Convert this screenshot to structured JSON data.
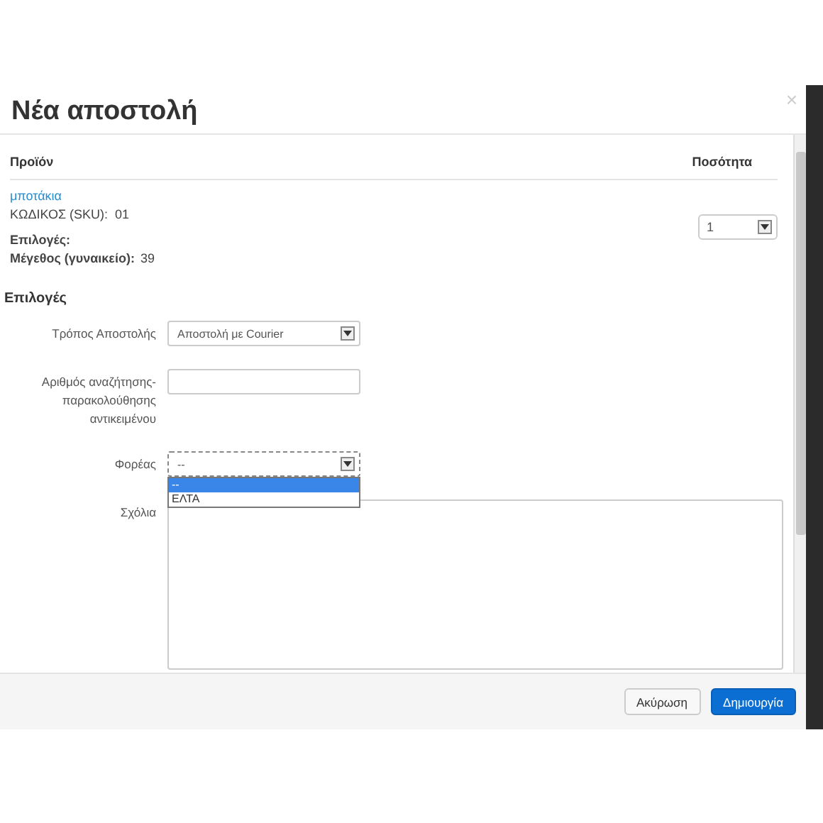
{
  "dialog": {
    "title": "Νέα αποστολή",
    "close": "×"
  },
  "products_table": {
    "columns": [
      "Προϊόν",
      "Ποσότητα"
    ],
    "rows": [
      {
        "name": "μποτάκια",
        "sku_label": "ΚΩΔΙΚΟΣ (SKU):",
        "sku": "01",
        "options_label": "Επιλογές:",
        "option_name": "Μέγεθος (γυναικείο):",
        "option_value": "39",
        "quantity": "1"
      }
    ]
  },
  "options_section": {
    "title": "Επιλογές",
    "fields": [
      {
        "kind": "select",
        "label": "Τρόπος Αποστολής",
        "value": "Αποστολή με Courier"
      },
      {
        "kind": "input",
        "label": "Αριθμός αναζήτησης-παρακολούθησης αντικειμένου"
      },
      {
        "kind": "select",
        "label": "Φορέας",
        "value": "--",
        "expanded": true,
        "options": [
          {
            "label": "--",
            "selected": true
          },
          {
            "label": "ΕΛΤΑ",
            "selected": false
          }
        ]
      },
      {
        "kind": "textarea",
        "label": "Σχόλια"
      }
    ]
  },
  "buttons": [
    {
      "label": "Ακύρωση",
      "kind": "default"
    },
    {
      "label": "Δημιουργία",
      "kind": "primary"
    }
  ]
}
